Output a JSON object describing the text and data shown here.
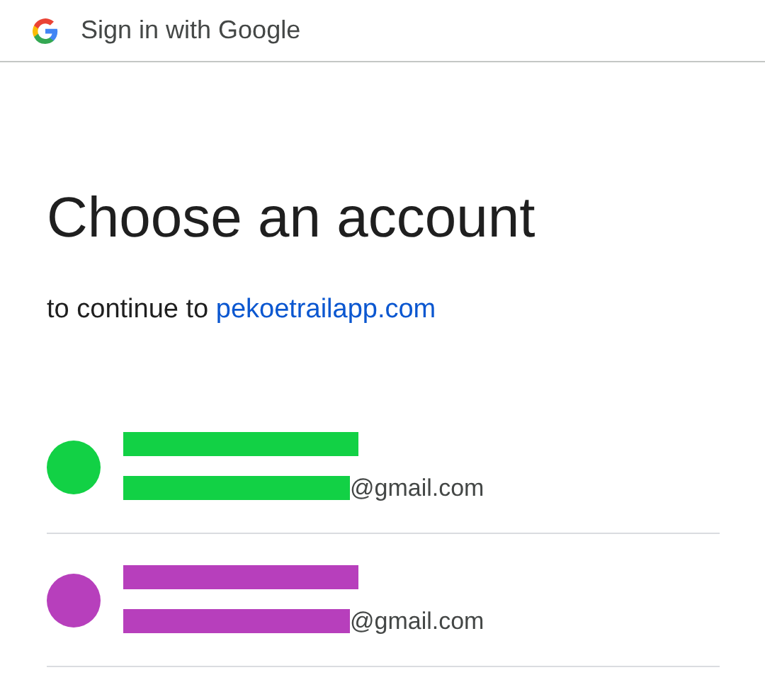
{
  "header": {
    "title": "Sign in with Google"
  },
  "heading": "Choose an account",
  "subtitle": {
    "text": "to continue to",
    "link": "pekoetrailapp.com"
  },
  "accounts": [
    {
      "email": "@gmail.com",
      "color": "#12d145"
    },
    {
      "email": "@gmail.com",
      "color": "#b73fbc"
    }
  ]
}
